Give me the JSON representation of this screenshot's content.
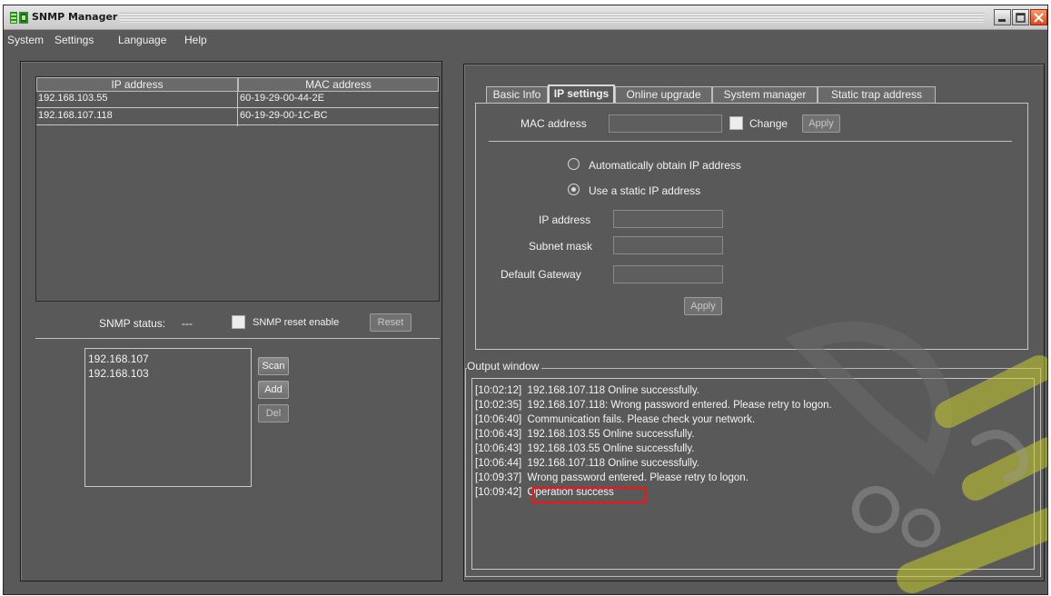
{
  "window": {
    "title": "SNMP Manager"
  },
  "menu": [
    "System",
    "Settings",
    "Language",
    "Help"
  ],
  "device_table": {
    "columns": [
      "IP address",
      "MAC address"
    ],
    "rows": [
      [
        "192.168.103.55",
        "60-19-29-00-44-2E"
      ],
      [
        "192.168.107.118",
        "60-19-29-00-1C-BC"
      ]
    ]
  },
  "snmp": {
    "status_label": "SNMP status:",
    "status_value": "---",
    "reset_enable_label": "SNMP reset enable",
    "reset_button": "Reset"
  },
  "subnets": {
    "items": [
      "192.168.107",
      "192.168.103"
    ],
    "scan_button": "Scan",
    "add_button": "Add",
    "del_button": "Del"
  },
  "tabs": [
    "Basic Info",
    "IP settings",
    "Online upgrade",
    "System manager",
    "Static trap address"
  ],
  "active_tab": "IP settings",
  "ip_settings": {
    "mac_label": "MAC address",
    "mac_value": "",
    "change_label": "Change",
    "mac_apply": "Apply",
    "auto_ip_label": "Automatically obtain IP address",
    "static_ip_label": "Use a static IP address",
    "selected_mode": "static",
    "ip_label": "IP address",
    "ip_value": "",
    "subnet_label": "Subnet mask",
    "subnet_value": "",
    "gateway_label": "Default Gateway",
    "gateway_value": "",
    "apply_button": "Apply"
  },
  "output": {
    "title": "Output window",
    "lines": [
      {
        "time": "[10:02:12]",
        "msg": "192.168.107.118 Online successfully."
      },
      {
        "time": "[10:02:35]",
        "msg": "192.168.107.118: Wrong password entered. Please retry to logon."
      },
      {
        "time": "[10:06:40]",
        "msg": " Communication fails. Please check your network."
      },
      {
        "time": "[10:06:43]",
        "msg": "192.168.103.55 Online successfully."
      },
      {
        "time": "[10:06:43]",
        "msg": "192.168.103.55 Online successfully."
      },
      {
        "time": "[10:06:44]",
        "msg": "192.168.107.118 Online successfully."
      },
      {
        "time": "[10:09:37]",
        "msg": "Wrong password entered. Please retry to logon."
      },
      {
        "time": "[10:09:42]",
        "msg": "Operation success"
      }
    ],
    "highlight_color": "#ff1010"
  },
  "colors": {
    "window_bg": "#595959",
    "close_button": "#e0431b"
  }
}
